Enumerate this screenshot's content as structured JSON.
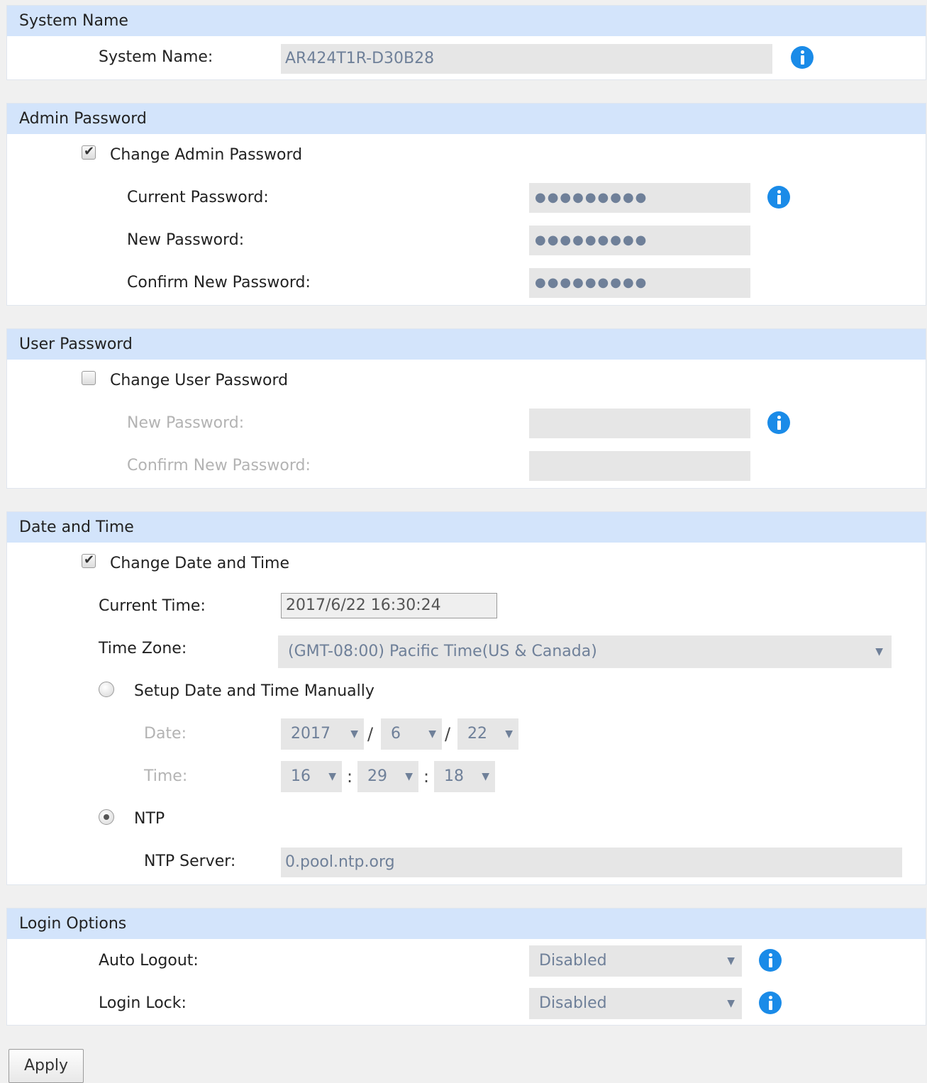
{
  "system_name": {
    "section_title": "System Name",
    "label": "System Name:",
    "value": "AR424T1R-D30B28"
  },
  "admin_password": {
    "section_title": "Admin Password",
    "change_label": "Change Admin Password",
    "change_checked": true,
    "current_label": "Current Password:",
    "current_value": "●●●●●●●●●",
    "new_label": "New Password:",
    "new_value": "●●●●●●●●●",
    "confirm_label": "Confirm New Password:",
    "confirm_value": "●●●●●●●●●"
  },
  "user_password": {
    "section_title": "User Password",
    "change_label": "Change User Password",
    "change_checked": false,
    "new_label": "New Password:",
    "confirm_label": "Confirm New Password:"
  },
  "date_time": {
    "section_title": "Date and Time",
    "change_label": "Change Date and Time",
    "change_checked": true,
    "current_time_label": "Current Time:",
    "current_time_value": "2017/6/22 16:30:24",
    "timezone_label": "Time Zone:",
    "timezone_value": "(GMT-08:00) Pacific Time(US & Canada)",
    "manual_label": "Setup Date and Time Manually",
    "date_label": "Date:",
    "date_year": "2017",
    "date_month": "6",
    "date_day": "22",
    "date_sep": "/",
    "time_label": "Time:",
    "time_hour": "16",
    "time_minute": "29",
    "time_second": "18",
    "time_sep": ":",
    "ntp_label": "NTP",
    "ntp_server_label": "NTP Server:",
    "ntp_server_value": "0.pool.ntp.org",
    "selected_mode": "NTP"
  },
  "login_options": {
    "section_title": "Login Options",
    "auto_logout_label": "Auto Logout:",
    "auto_logout_value": "Disabled",
    "login_lock_label": "Login Lock:",
    "login_lock_value": "Disabled"
  },
  "apply_label": "Apply",
  "colors": {
    "header_bg": "#d3e4fb",
    "info_icon": "#1a8be8",
    "field_bg": "#e6e6e6",
    "field_text": "#6f8099"
  },
  "icons": {
    "info": "info-icon",
    "dropdown": "chevron-down-icon",
    "checkbox": "checkbox-icon",
    "radio": "radio-icon"
  }
}
